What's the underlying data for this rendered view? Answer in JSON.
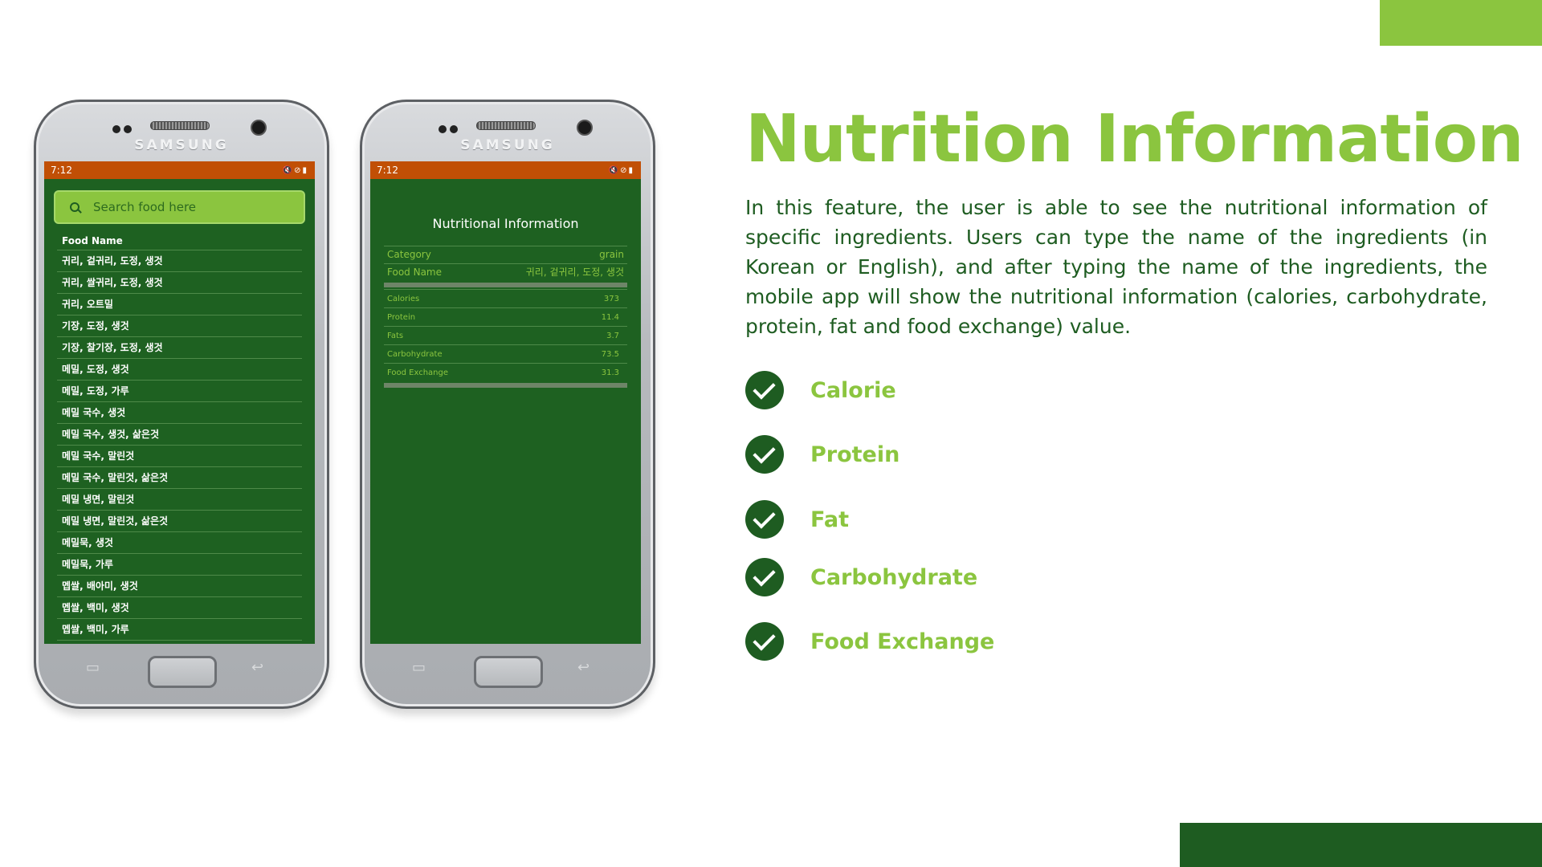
{
  "colors": {
    "accent_green": "#8bc53f",
    "dark_green": "#1e5c21",
    "status_orange": "#c14f05",
    "screen_green": "#1e6121"
  },
  "phone_brand": "SAMSUNG",
  "status_time": "7:12",
  "status_icons": [
    "image-icon",
    "mute-icon",
    "blocked-icon",
    "battery-icon"
  ],
  "search": {
    "icon": "search-icon",
    "placeholder": "Search food here"
  },
  "food_list": {
    "header": "Food Name",
    "items": [
      "귀리, 겉귀리, 도정, 생것",
      "귀리, 쌀귀리, 도정, 생것",
      "귀리, 오트밀",
      "기장, 도정, 생것",
      "기장, 찰기장, 도정, 생것",
      "메밀, 도정, 생것",
      "메밀, 도정, 가루",
      "메밀 국수, 생것",
      "메밀 국수, 생것, 삶은것",
      "메밀 국수, 말린것",
      "메밀 국수, 말린것, 삶은것",
      "메밀 냉면, 말린것",
      "메밀 냉면, 말린것, 삶은것",
      "메밀묵, 생것",
      "메밀묵, 가루",
      "멥쌀, 배아미, 생것",
      "멥쌀, 백미, 생것",
      "멥쌀, 백미, 가루"
    ]
  },
  "nutrition_screen": {
    "title": "Nutritional Information",
    "category_label": "Category",
    "category_value": "grain",
    "food_name_label": "Food Name",
    "food_name_value": "귀리, 겉귀리, 도정, 생것",
    "rows": [
      {
        "label": "Calories",
        "value": "373"
      },
      {
        "label": "Protein",
        "value": "11.4"
      },
      {
        "label": "Fats",
        "value": "3.7"
      },
      {
        "label": "Carbohydrate",
        "value": "73.5"
      },
      {
        "label": "Food Exchange",
        "value": "31.3"
      }
    ]
  },
  "slide": {
    "title": "Nutrition Information",
    "description": "In this feature, the user is able to see the nutritional information of specific ingredients. Users can type the name of the ingredients (in Korean or English), and after typing the name of the ingredients, the mobile app will show the nutritional information (calories, carbohydrate, protein, fat and food exchange) value.",
    "features": [
      {
        "icon": "check-icon",
        "label": "Calorie"
      },
      {
        "icon": "check-icon",
        "label": "Protein"
      },
      {
        "icon": "check-icon",
        "label": "Fat"
      },
      {
        "icon": "check-icon",
        "label": "Carbohydrate"
      },
      {
        "icon": "check-icon",
        "label": "Food Exchange"
      }
    ]
  }
}
